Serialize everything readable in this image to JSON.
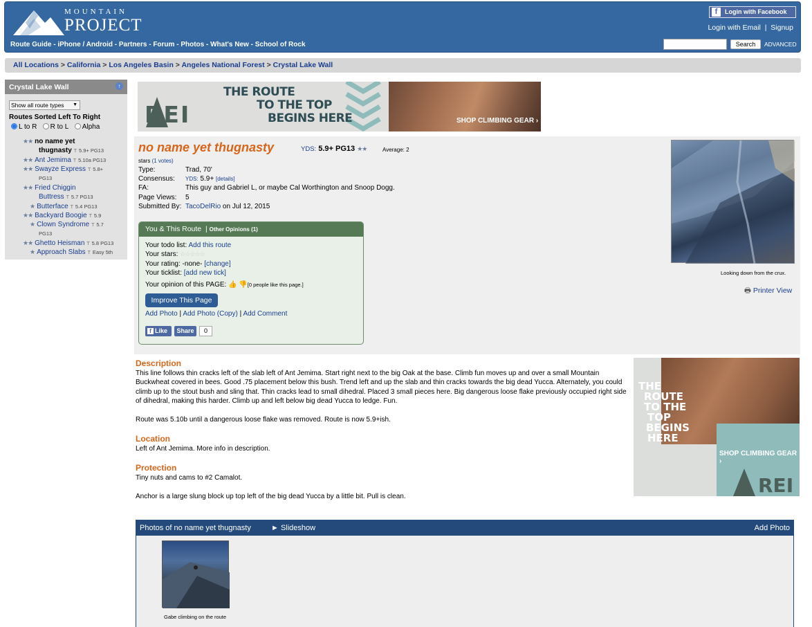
{
  "header": {
    "logo_top": "MOUNTAIN",
    "logo_bottom": "PROJECT",
    "nav": [
      "Route Guide",
      "iPhone / Android",
      "Partners",
      "Forum",
      "Photos",
      "What's New",
      "School of Rock"
    ],
    "fb_login": "Login with Facebook",
    "email_login": "Login with Email",
    "signup": "Signup",
    "search_value": "",
    "search_button": "Search",
    "advanced": "ADVANCED"
  },
  "breadcrumb": [
    "All Locations",
    "California",
    "Los Angeles Basin",
    "Angeles National Forest",
    "Crystal Lake Wall"
  ],
  "sidebar": {
    "title": "Crystal Lake Wall",
    "filter": "Show all route types",
    "sort_title": "Routes Sorted Left To Right",
    "sort_options": [
      "L to R",
      "R to L",
      "Alpha"
    ],
    "routes": [
      {
        "stars": "★★",
        "name": "no name yet",
        "name2": "thugnasty",
        "type": "T",
        "grade": "5.9+ PG13",
        "current": true
      },
      {
        "stars": "★★",
        "name": "Ant Jemima",
        "type": "T",
        "grade": "5.10a PG13"
      },
      {
        "stars": "★★",
        "name": "Swayze Express",
        "type": "T",
        "grade": "5.8+",
        "grade2": "PG13"
      },
      {
        "stars": "★★",
        "name": "Fried Chiggin",
        "name2": "Buttress",
        "type": "T",
        "grade": "5.7 PG13"
      },
      {
        "stars": "★",
        "name": "Butterface",
        "type": "T",
        "grade": "5.4 PG13"
      },
      {
        "stars": "★★",
        "name": "Backyard Boogie",
        "type": "T",
        "grade": "5.9"
      },
      {
        "stars": "★",
        "name": "Clown Syndrome",
        "type": "T",
        "grade": "5.7",
        "grade2": "PG13"
      },
      {
        "stars": "★★",
        "name": "Ghetto Heisman",
        "type": "T",
        "grade": "5.8 PG13"
      },
      {
        "stars": "★",
        "name": "Approach Slabs",
        "type": "T",
        "grade": "Easy 5th"
      }
    ]
  },
  "ad_banner": {
    "headline_1": "THE ROUTE",
    "headline_2": "TO THE TOP",
    "headline_3": "BEGINS HERE",
    "shop": "SHOP CLIMBING GEAR ›",
    "brand": "REI"
  },
  "route": {
    "title": "no name yet thugnasty",
    "yds_label": "YDS:",
    "grade": "5.9+ PG13",
    "stars": "★★",
    "average": "Average: 2",
    "stars_word": "stars",
    "votes": "(1 votes)",
    "info": [
      {
        "label": "Type:",
        "value": "Trad, 70'"
      },
      {
        "label": "Consensus:",
        "yds": "YDS:",
        "value": "5.9+",
        "details": "[details]"
      },
      {
        "label": "FA:",
        "value": "This guy and Gabriel L, or maybe Cal Worthington and Snoop Dogg."
      },
      {
        "label": "Page Views:",
        "value": "5"
      },
      {
        "label": "Submitted By:",
        "user": "TacoDelRio",
        "value": " on Jul 12, 2015"
      }
    ]
  },
  "you_box": {
    "title": "You & This Route",
    "other": "Other Opinions (1)",
    "todo_label": "Your todo list:",
    "todo_link": "Add this route",
    "stars_label": "Your stars:",
    "rating_label": "Your rating: -none-",
    "rating_link": "[change]",
    "ticklist_label": "Your ticklist:",
    "ticklist_link": "[add new tick]",
    "opinion_label": "Your opinion of this PAGE:",
    "opinion_count": "[0 people like this page.]",
    "improve": "Improve This Page",
    "add_photo": "Add Photo",
    "add_photo_copy": "Add Photo (Copy)",
    "add_comment": "Add Comment",
    "like": "Like",
    "share": "Share",
    "share_count": "0"
  },
  "photo": {
    "caption": "Looking down from the crux.",
    "printer": "Printer View"
  },
  "description": {
    "title": "Description",
    "p1": "This line follows thin cracks left of the slab left of Ant Jemima. Start right next to the big Oak at the base. Climb fun moves up and over a small Mountain Buckwheat covered in bees. Good .75 placement below this bush. Trend left and up the slab and thin cracks towards the big dead Yucca. Alternately, you could climb up to the stout bush and sling that. Thin cracks lead to small dihedral. Placed 3 small pieces here. Big dangerous loose flake previously occupied right side of dihedral, making this harder. Climb up and left below big dead Yucca to ledge. Fun.",
    "p2": "Route was 5.10b until a dangerous loose flake was removed. Route is now 5.9+ish."
  },
  "location": {
    "title": "Location",
    "text": "Left of Ant Jemima. More info in description."
  },
  "protection": {
    "title": "Protection",
    "p1": "Tiny nuts and cams to #2 Camalot.",
    "p2": "Anchor is a large slung block up top left of the big dead Yucca by a little bit. Pull is clean."
  },
  "ad_right": {
    "headline": "THE ROUTE TO THE TOP BEGINS HERE",
    "l1": "THE",
    "l2": "ROUTE",
    "l3": "TO THE",
    "l4": "TOP",
    "l5": "BEGINS",
    "l6": "HERE",
    "shop": "SHOP CLIMBING GEAR ›",
    "brand": "REI"
  },
  "photos_panel": {
    "title": "Photos of no name yet thugnasty",
    "slideshow": "► Slideshow",
    "add_photo": "Add Photo",
    "thumb_caption": "Gabe climbing on the route"
  }
}
